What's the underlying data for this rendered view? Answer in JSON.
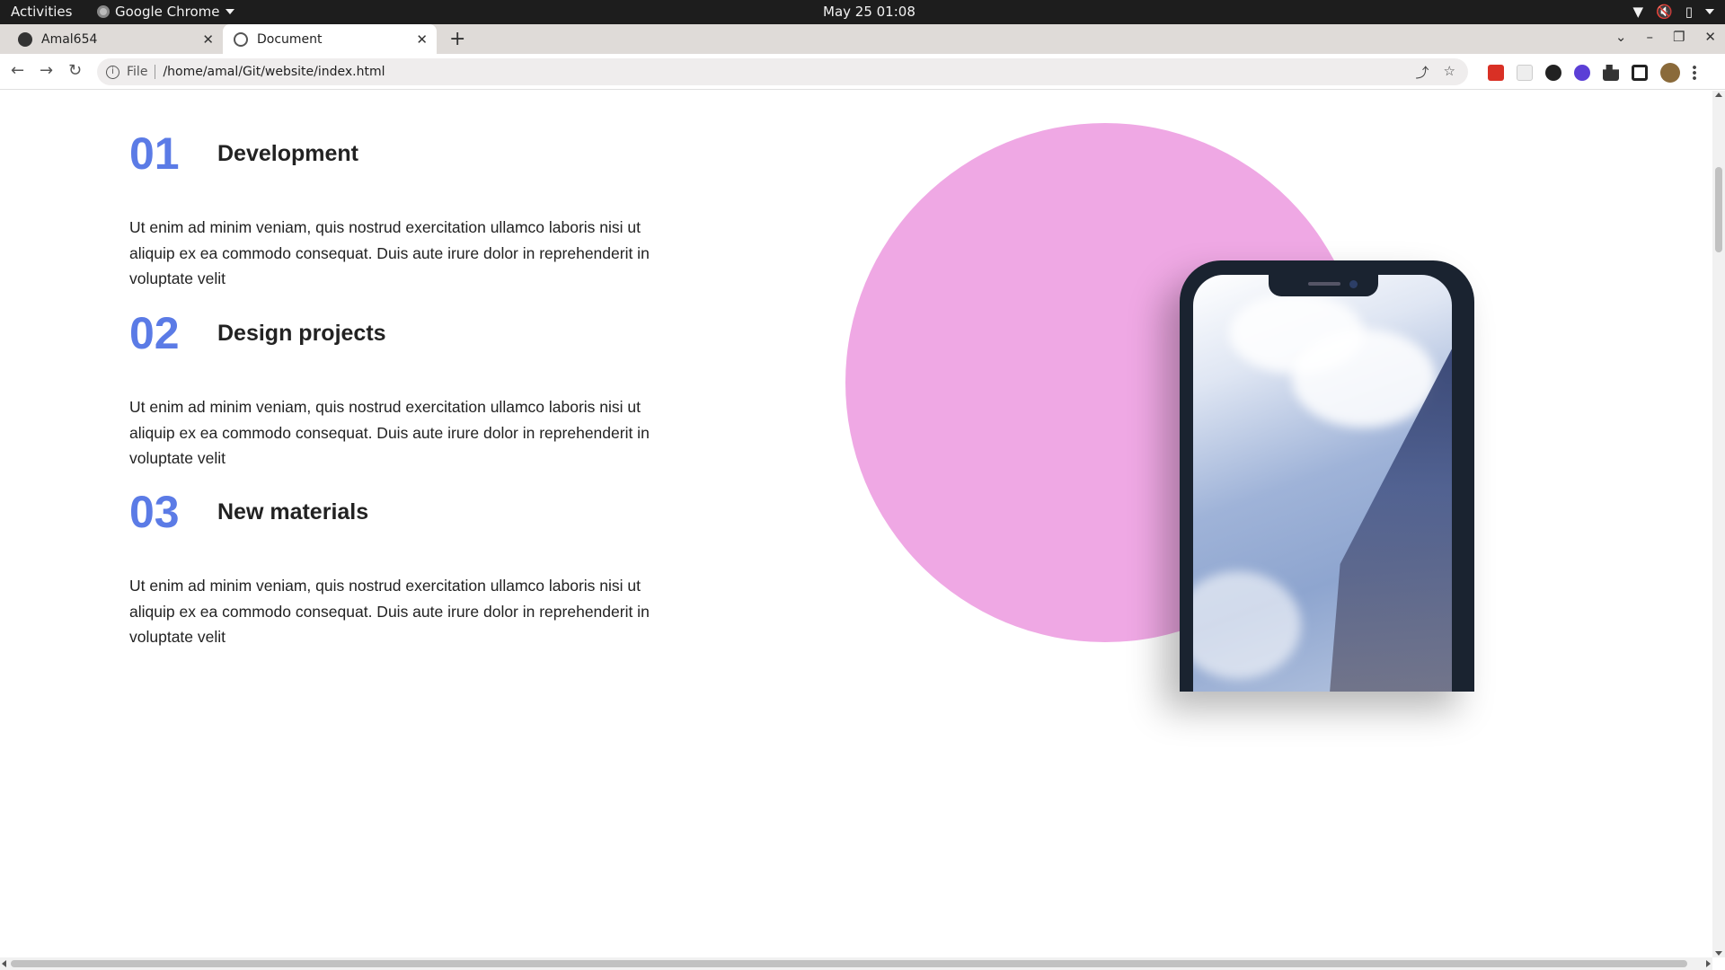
{
  "system_bar": {
    "activities": "Activities",
    "app_name": "Google Chrome",
    "clock": "May 25  01:08",
    "tray_icons": [
      "wifi-icon",
      "volume-muted-icon",
      "battery-icon",
      "system-menu-chevron-icon"
    ]
  },
  "tabs": [
    {
      "title": "Amal654",
      "favicon": "github-icon",
      "active": false
    },
    {
      "title": "Document",
      "favicon": "globe-icon",
      "active": true
    }
  ],
  "toolbar": {
    "scheme_label": "File",
    "url": "/home/amal/Git/website/index.html",
    "extensions": [
      "red-extension-icon",
      "blank-extension-icon",
      "openai-extension-icon",
      "purple-extension-icon",
      "puzzle-icon",
      "side-panel-icon",
      "profile-avatar",
      "kebab-menu-icon"
    ]
  },
  "page": {
    "features": [
      {
        "number": "01",
        "title": "Development",
        "text": "Ut enim ad minim veniam, quis nostrud exercitation ullamco laboris nisi ut aliquip ex ea commodo consequat. Duis aute irure dolor in reprehenderit in voluptate velit"
      },
      {
        "number": "02",
        "title": "Design projects",
        "text": "Ut enim ad minim veniam, quis nostrud exercitation ullamco laboris nisi ut aliquip ex ea commodo consequat. Duis aute irure dolor in reprehenderit in voluptate velit"
      },
      {
        "number": "03",
        "title": "New materials",
        "text": "Ut enim ad minim veniam, quis nostrud exercitation ullamco laboris nisi ut aliquip ex ea commodo consequat. Duis aute irure dolor in reprehenderit in voluptate velit"
      }
    ],
    "colors": {
      "number_accent": "#5b7be6",
      "circle": "#efa8e4",
      "phone_frame": "#1a2330"
    }
  }
}
